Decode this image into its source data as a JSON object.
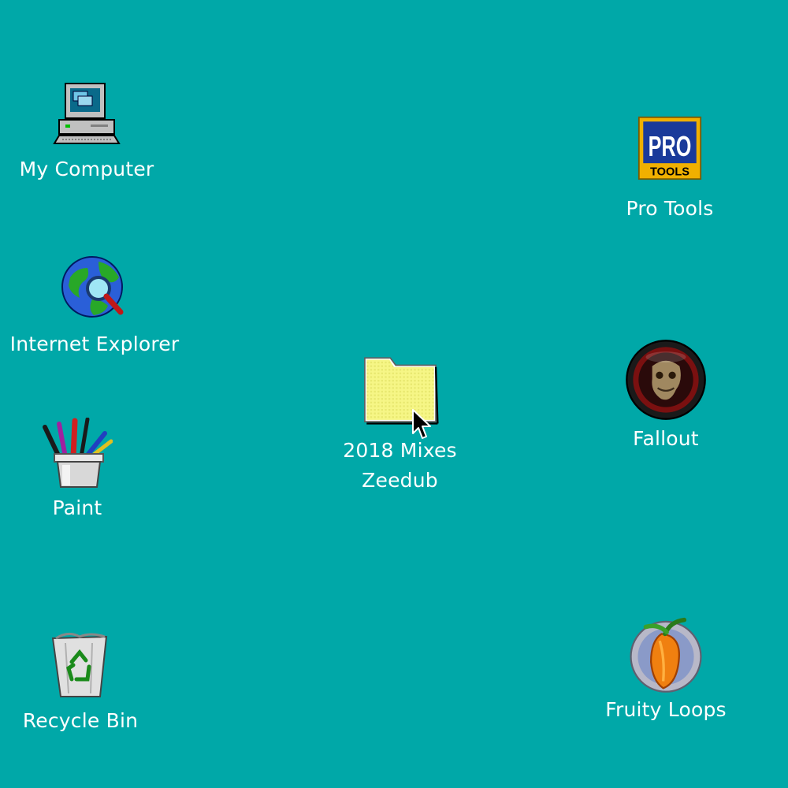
{
  "desktop": {
    "background_color": "#00a8a8",
    "icons": [
      {
        "label": "My Computer",
        "icon": "computer-icon"
      },
      {
        "label": "Internet Explorer",
        "icon": "internet-explorer-icon"
      },
      {
        "label": "Paint",
        "icon": "paint-icon"
      },
      {
        "label": "Recycle Bin",
        "icon": "recycle-bin-icon"
      },
      {
        "label_line1": "2018 Mixes",
        "label_line2": "Zeedub",
        "icon": "folder-icon"
      },
      {
        "label": "Pro Tools",
        "icon": "pro-tools-icon",
        "logo_top": "PRO",
        "logo_bottom": "TOOLS"
      },
      {
        "label": "Fallout",
        "icon": "fallout-icon"
      },
      {
        "label": "Fruity Loops",
        "icon": "fruity-loops-icon"
      }
    ]
  }
}
